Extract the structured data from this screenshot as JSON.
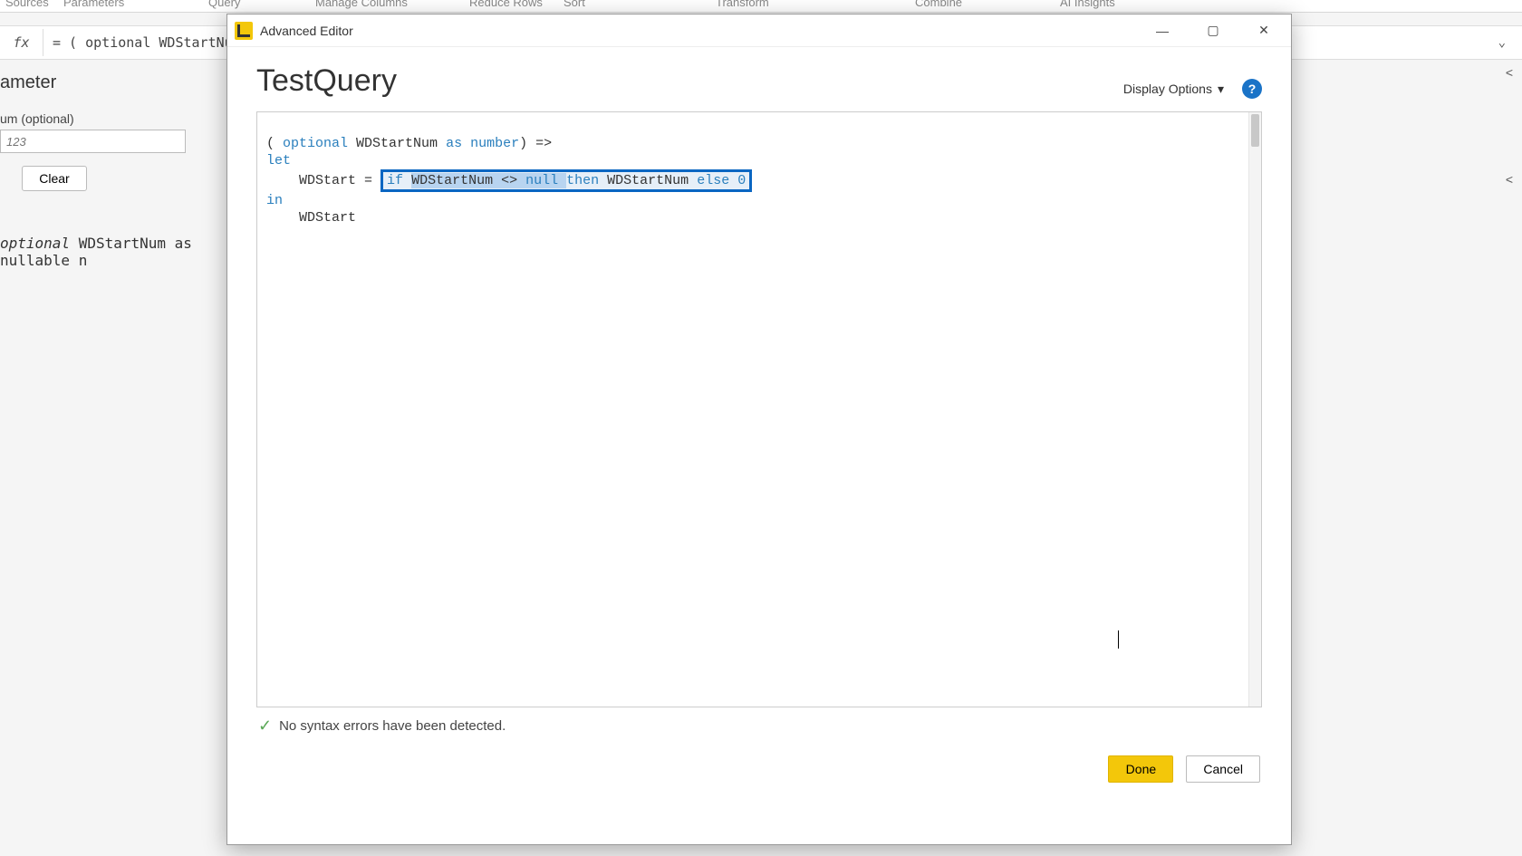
{
  "ribbon": {
    "groups": [
      "Sources",
      "Parameters",
      "Query",
      "Manage Columns",
      "Reduce Rows",
      "Sort",
      "Transform",
      "Combine",
      "AI Insights"
    ]
  },
  "formula_bar": {
    "fx": "fx",
    "text": "= ( optional WDStartNum a"
  },
  "bg_panel": {
    "heading": "ameter",
    "label": "um (optional)",
    "placeholder": "123",
    "clear": "Clear",
    "type_line_prefix": "optional ",
    "type_line_id": "WDStartNum",
    "type_line_suffix": " as nullable n"
  },
  "dialog": {
    "title": "Advanced Editor",
    "query_name": "TestQuery",
    "display_options": "Display Options",
    "status": "No syntax errors have been detected.",
    "done": "Done",
    "cancel": "Cancel"
  },
  "code": {
    "l1_open": "( ",
    "l1_optional": "optional",
    "l1_sp1": " ",
    "l1_id": "WDStartNum",
    "l1_sp2": " ",
    "l1_as": "as",
    "l1_sp3": " ",
    "l1_number": "number",
    "l1_close": ") =>",
    "l2_let": "let",
    "l3_indent": "    ",
    "l3_var": "WDStart",
    "l3_eq": " = ",
    "l3_if": "if",
    "l3_sp1": " ",
    "l3_sel1": "WDStartNum <> ",
    "l3_null": "null ",
    "l3_then": "then",
    "l3_sp2": " ",
    "l3_id2": "WDStartNum",
    "l3_sp3": " ",
    "l3_else": "else",
    "l3_sp4": " ",
    "l3_zero": "0",
    "l4_in": "in",
    "l5_indent": "    ",
    "l5_out": "WDStart"
  }
}
